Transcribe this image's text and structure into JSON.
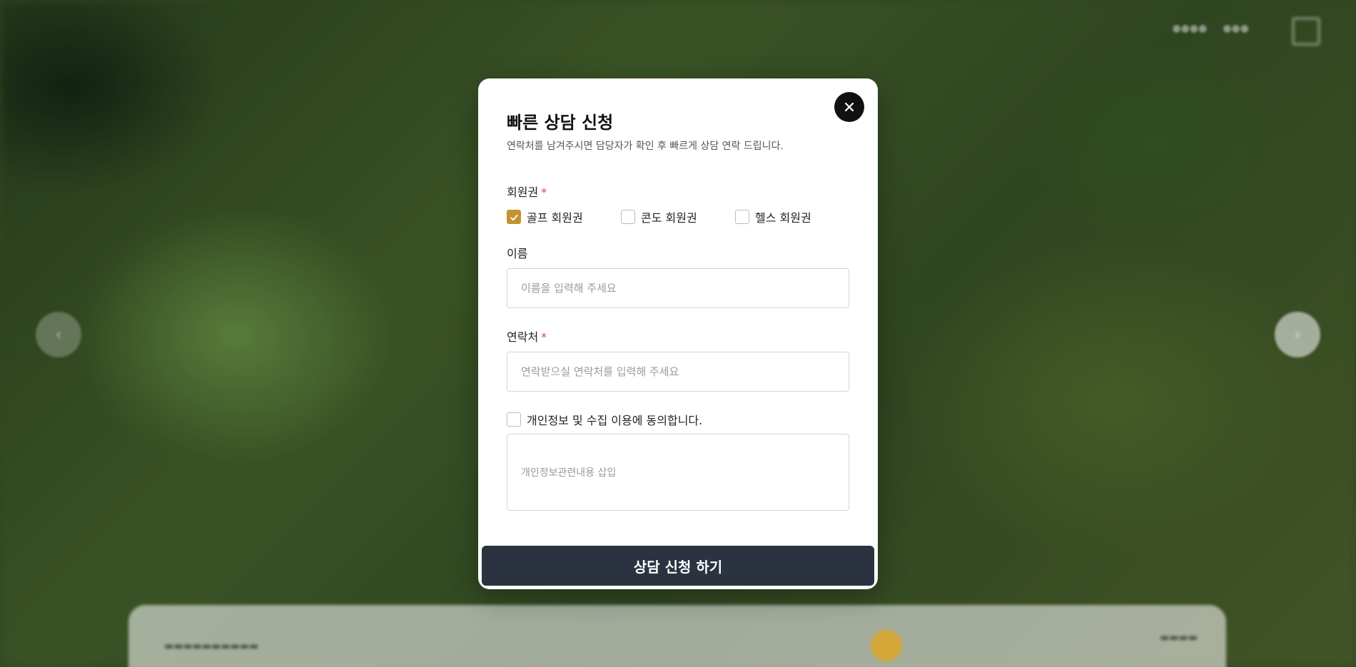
{
  "modal": {
    "title": "빠른 상담 신청",
    "subtitle": "연락처를 남겨주시면 담당자가 확인 후 빠르게 상담 연락 드립니다.",
    "close_icon": "close-icon",
    "membership": {
      "label": "회원권",
      "required_mark": "*",
      "options": [
        {
          "label": "골프 회원권",
          "checked": true
        },
        {
          "label": "콘도 회원권",
          "checked": false
        },
        {
          "label": "헬스 회원권",
          "checked": false
        }
      ]
    },
    "name": {
      "label": "이름",
      "placeholder": "이름을 입력해 주세요",
      "value": ""
    },
    "contact": {
      "label": "연락처",
      "required_mark": "*",
      "placeholder": "연락받으실 연락처를 입력해 주세요",
      "value": ""
    },
    "agreement": {
      "label": "개인정보 및 수집 이용에 동의합니다.",
      "checked": false,
      "content_placeholder": "개인정보관련내용 삽입"
    },
    "submit_label": "상담 신청 하기"
  },
  "colors": {
    "accent_checked": "#c2932e",
    "submit_bg": "#2b3340",
    "required_mark": "#d14a2e"
  }
}
